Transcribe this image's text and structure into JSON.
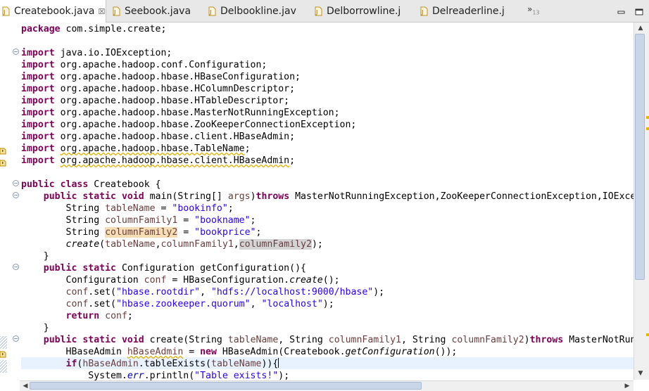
{
  "tabs": [
    {
      "label": "Createbook.java",
      "active": true,
      "close": "☒"
    },
    {
      "label": "Seebook.java"
    },
    {
      "label": "Delbookline.jav"
    },
    {
      "label": "Delborrowline.j"
    },
    {
      "label": "Delreaderline.j"
    }
  ],
  "overflow": {
    "label": "»",
    "count": "13"
  },
  "colors": {
    "keyword": "#7f0055",
    "string": "#2a00ff",
    "field": "#0000c0",
    "variable": "#6a3e3e",
    "current_line": "#e8f2fe",
    "occurrence": "#f5deb3",
    "scroll_thumb": "#c9d6ea"
  },
  "icons": [
    "java-file-icon",
    "minimize-icon",
    "maximize-icon",
    "warning-icon",
    "fold-icon"
  ],
  "code": {
    "l0": [
      "package",
      " com.simple.create;"
    ],
    "l2": [
      "import",
      " java.io.IOException;"
    ],
    "l3": [
      "import",
      " org.apache.hadoop.conf.Configuration;"
    ],
    "l4": [
      "import",
      " org.apache.hadoop.hbase.HBaseConfiguration;"
    ],
    "l5": [
      "import",
      " org.apache.hadoop.hbase.HColumnDescriptor;"
    ],
    "l6": [
      "import",
      " org.apache.hadoop.hbase.HTableDescriptor;"
    ],
    "l7": [
      "import",
      " org.apache.hadoop.hbase.MasterNotRunningException;"
    ],
    "l8": [
      "import",
      " org.apache.hadoop.hbase.ZooKeeperConnectionException;"
    ],
    "l9": [
      "import",
      " org.apache.hadoop.hbase.client.HBaseAdmin;"
    ],
    "l10": [
      "import",
      " ",
      "org.apache.hadoop.hbase.TableName",
      ";"
    ],
    "l11": [
      "import",
      " ",
      "org.apache.hadoop.hbase.client.HBaseAdmin",
      ";"
    ],
    "l13": [
      "public",
      " ",
      "class",
      " Createbook {"
    ],
    "l14": [
      "    ",
      "public",
      " ",
      "static",
      " ",
      "void",
      " main(String[] ",
      "args",
      ")",
      "throws",
      " MasterNotRunningException,ZooKeeperConnectionException,IOExce"
    ],
    "l15": [
      "        String ",
      "tableName",
      " = ",
      "\"bookinfo\"",
      ";"
    ],
    "l16": [
      "        String ",
      "columnFamily1",
      " = ",
      "\"bookname\"",
      ";"
    ],
    "l17": [
      "        String ",
      "columnFamily2",
      " = ",
      "\"bookprice\"",
      ";"
    ],
    "l18": [
      "        ",
      "create",
      "(",
      "tableName",
      ",",
      "columnFamily1",
      ",",
      "columnFamily2",
      ");"
    ],
    "l19": [
      "    }"
    ],
    "l20": [
      "    ",
      "public",
      " ",
      "static",
      " Configuration getConfiguration(){"
    ],
    "l21": [
      "        Configuration ",
      "conf",
      " = HBaseConfiguration.",
      "create",
      "();"
    ],
    "l22": [
      "        ",
      "conf",
      ".set(",
      "\"hbase.rootdir\"",
      ", ",
      "\"hdfs://localhost:9000/hbase\"",
      ");"
    ],
    "l23": [
      "        ",
      "conf",
      ".set(",
      "\"hbase.zookeeper.quorum\"",
      ", ",
      "\"localhost\"",
      ");"
    ],
    "l24": [
      "        ",
      "return",
      " ",
      "conf",
      ";"
    ],
    "l25": [
      "    }"
    ],
    "l26": [
      "    ",
      "public",
      " ",
      "static",
      " ",
      "void",
      " create(String ",
      "tableName",
      ", String ",
      "columnFamily1",
      ", String ",
      "columnFamily2",
      ")",
      "throws",
      " MasterNotRun"
    ],
    "l27": [
      "        HBaseAdmin ",
      "hBaseAdmin",
      " = ",
      "new",
      " HBaseAdmin(Createbook.",
      "getConfiguration",
      "());"
    ],
    "l28": [
      "        ",
      "if",
      "(",
      "hBaseAdmin",
      ".tableExists(",
      "tableName",
      ")){"
    ],
    "l29": [
      "            System.",
      "err",
      ".println(",
      "\"Table exists!\"",
      ");"
    ]
  }
}
